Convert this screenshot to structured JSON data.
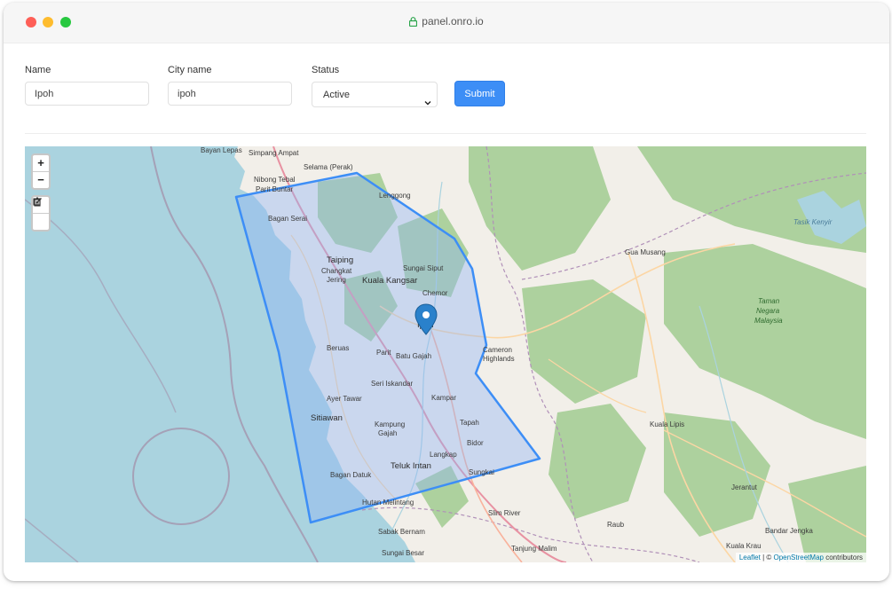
{
  "window": {
    "url": "panel.onro.io"
  },
  "form": {
    "name_label": "Name",
    "name_value": "Ipoh",
    "city_label": "City name",
    "city_value": "ipoh",
    "status_label": "Status",
    "status_value": "Active",
    "submit_label": "Submit"
  },
  "map": {
    "zoom_in": "+",
    "zoom_out": "−",
    "edit_tool_icon": "edit-icon",
    "delete_tool_icon": "trash-icon",
    "attribution": {
      "leaflet": "Leaflet",
      "separator": " | © ",
      "osm": "OpenStreetMap",
      "suffix": " contributors"
    },
    "places": [
      "Bayan Lepas",
      "Simpang Ampat",
      "Selama (Perak)",
      "Nibong Tebal",
      "Parit Buntar",
      "Lenggong",
      "Bagan Serai",
      "Taiping",
      "Changkat Jering",
      "Sungai Siput",
      "Kuala Kangsar",
      "Chemor",
      "Ipoh",
      "Beruas",
      "Parit",
      "Batu Gajah",
      "Cameron Highlands",
      "Seri Iskandar",
      "Ayer Tawar",
      "Kampar",
      "Sitiawan",
      "Kampung Gajah",
      "Tapah",
      "Bidor",
      "Langkap",
      "Teluk Intan",
      "Sungkai",
      "Bagan Datuk",
      "Hutan Melintang",
      "Slim River",
      "Sabak Bernam",
      "Sungai Besar",
      "Tanjung Malim",
      "Gua Musang",
      "Taman Negara Malaysia",
      "Tasik Kenyir",
      "Kuala Lipis",
      "Jerantut",
      "Raub",
      "Bandar Jengka",
      "Kuala Krau"
    ],
    "colors": {
      "polygon_stroke": "#3d8ef6",
      "polygon_fill": "#8fb3f5",
      "marker": "#2a81cb",
      "sea": "#aad3df",
      "forest": "#add19e",
      "land": "#f2efe9"
    }
  }
}
